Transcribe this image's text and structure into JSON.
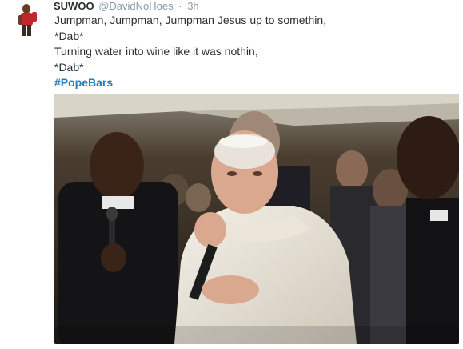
{
  "tweet": {
    "display_name": "SUWOO",
    "handle": "@DavidNoHoes",
    "separator": "·",
    "time": "3h",
    "lines": [
      "Jumpman, Jumpman, Jumpman Jesus up to somethin,",
      "*Dab*",
      "Turning water into wine like it was nothin,",
      "*Dab*"
    ],
    "hashtag": "#PopeBars",
    "colors": {
      "link": "#2b7bb9",
      "meta": "#8899a6",
      "text": "#292f33"
    }
  }
}
